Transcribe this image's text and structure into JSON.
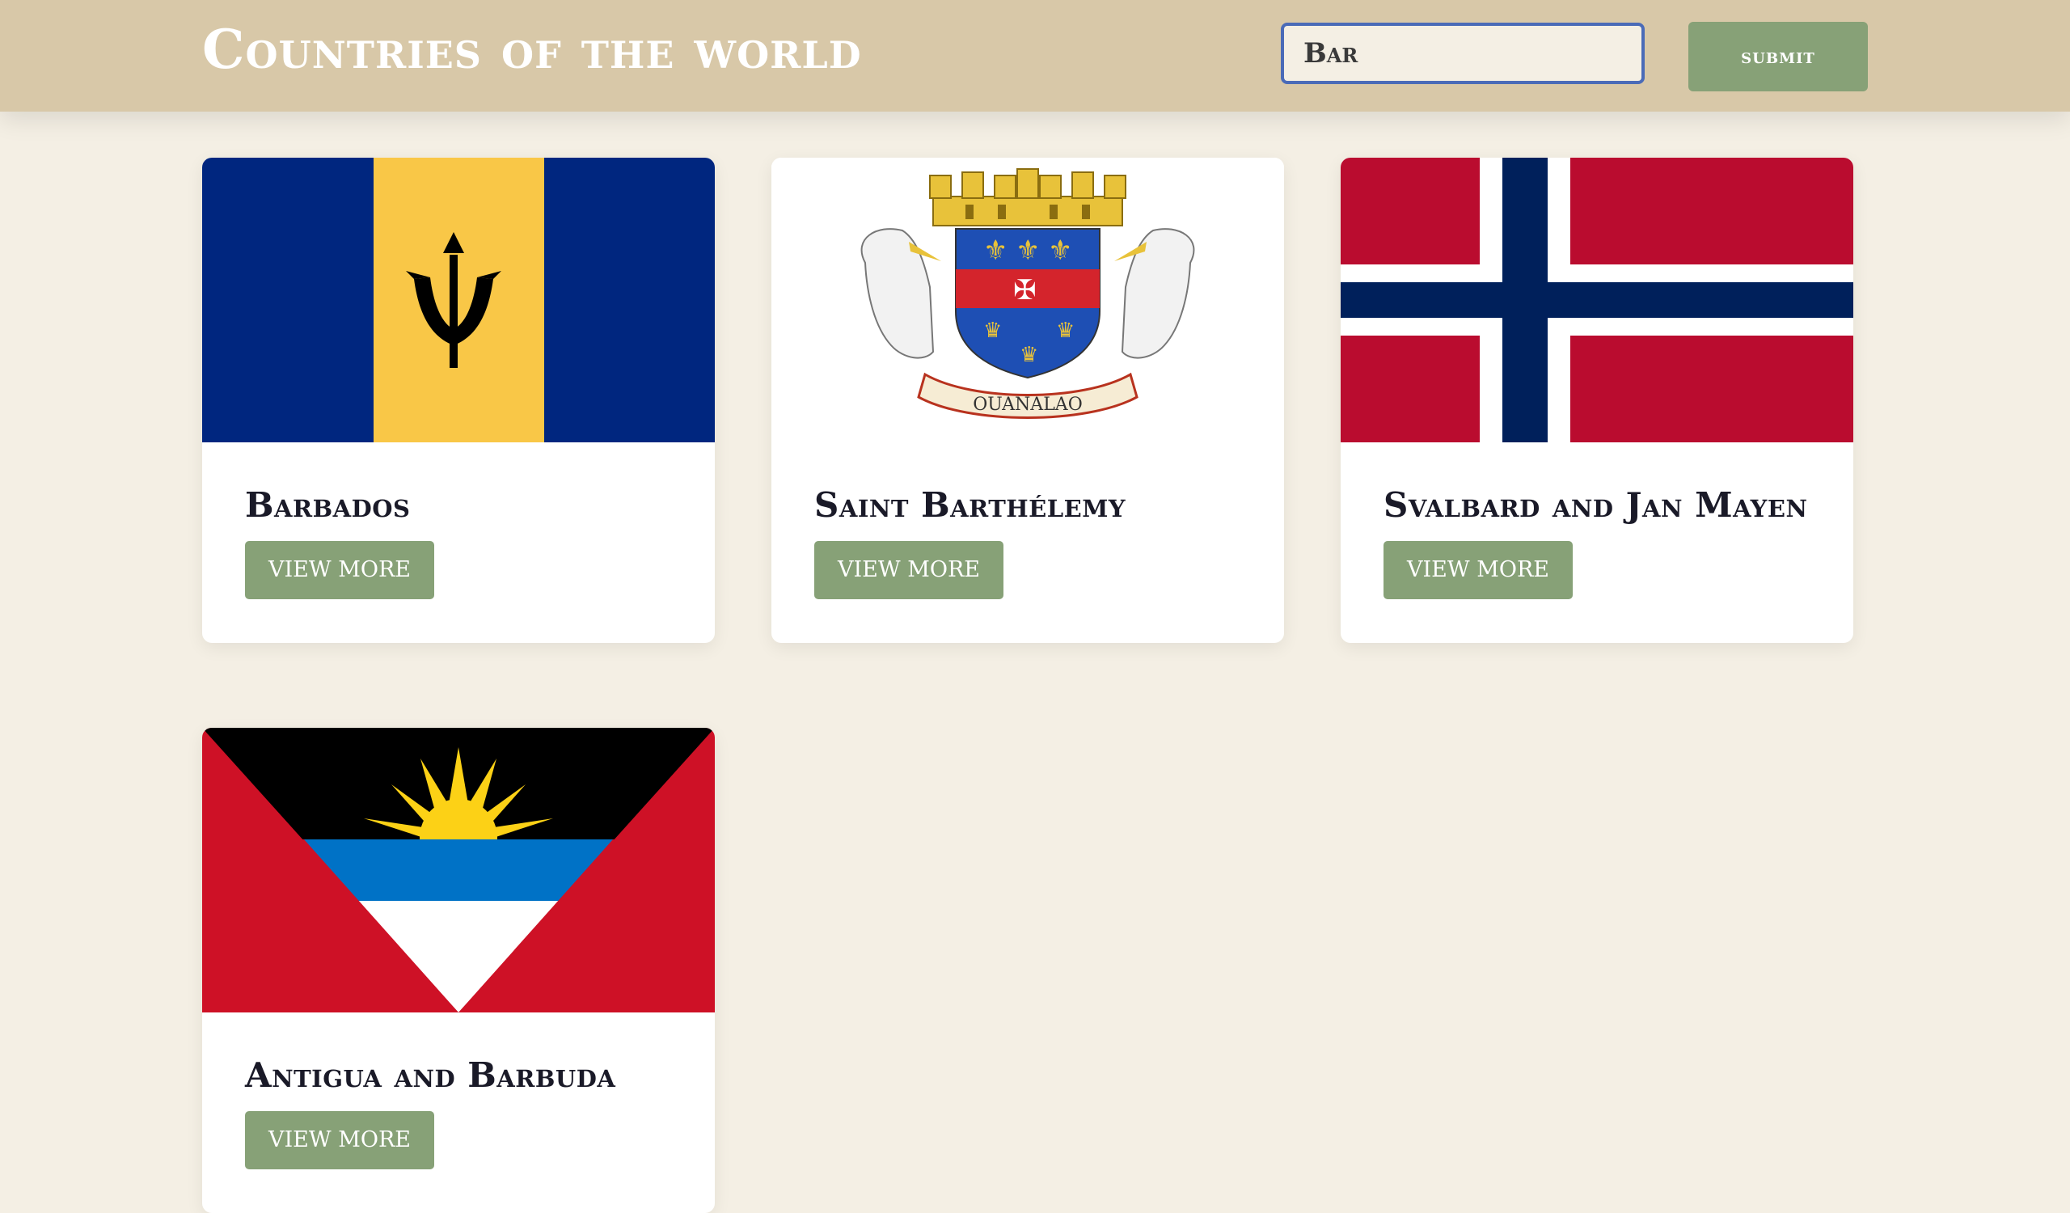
{
  "header": {
    "title": "Countries of the world",
    "search_value": "Bar",
    "submit_label": "submit"
  },
  "colors": {
    "header_bg": "#d8c8a8",
    "page_bg": "#f4efe4",
    "accent_button": "#87a177",
    "input_border": "#4a6bb8"
  },
  "countries": [
    {
      "name": "Barbados",
      "button_label": "VIEW MORE",
      "flag": "barbados-flag"
    },
    {
      "name": "Saint Barthélemy",
      "button_label": "VIEW MORE",
      "flag": "saint-barthelemy-coat-of-arms",
      "motto": "OUANALAO"
    },
    {
      "name": "Svalbard and Jan Mayen",
      "button_label": "VIEW MORE",
      "flag": "svalbard-jan-mayen-flag"
    },
    {
      "name": "Antigua and Barbuda",
      "button_label": "VIEW MORE",
      "flag": "antigua-barbuda-flag"
    }
  ]
}
